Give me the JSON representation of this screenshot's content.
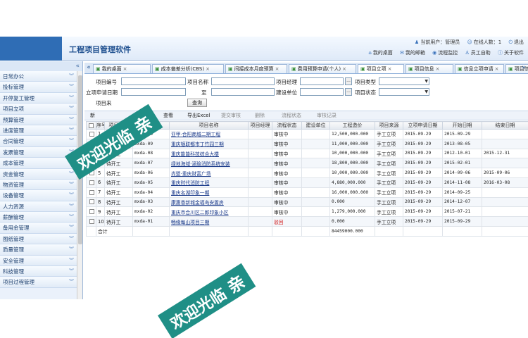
{
  "app": {
    "title": "工程项目管理软件",
    "current_user": "当前用户：管理员",
    "online_count": "在线人数：1",
    "logout": "退出",
    "links": [
      "我的桌面",
      "我的邮箱",
      "流程监控",
      "员工自助",
      "关于软件"
    ]
  },
  "sidebar": {
    "collapse_glyph": "«",
    "items": [
      "日常办公",
      "投标管理",
      "开停复工管理",
      "项目立项",
      "预算管理",
      "进度管理",
      "合同管理",
      "发票管理",
      "成本管理",
      "资金管理",
      "物资管理",
      "设备管理",
      "人力资源",
      "薪酬管理",
      "备用金管理",
      "图纸管理",
      "质量管理",
      "安全管理",
      "科技管理",
      "项目过程管理"
    ]
  },
  "tabs": [
    {
      "label": "我的桌面",
      "active": false
    },
    {
      "label": "成本偏差分析(CBS)",
      "active": false
    },
    {
      "label": "间接成本月度预算",
      "active": false
    },
    {
      "label": "费用预算申请(个人)",
      "active": false
    },
    {
      "label": "项目立项",
      "active": true
    },
    {
      "label": "项目信息",
      "active": false
    },
    {
      "label": "信息立项申请",
      "active": false
    },
    {
      "label": "项目信息一览",
      "active": false
    }
  ],
  "form": {
    "project_no": "项目编号",
    "project_name": "项目名称",
    "project_manager": "项目经理",
    "project_type": "项目类型",
    "apply_date": "立项申请日期",
    "to": "至",
    "build_unit": "建设单位",
    "project_status": "项目状态",
    "project_source": "项目来",
    "query": "查询"
  },
  "toolbar": {
    "buttons": [
      "新",
      "查看",
      "导出Excel",
      "提交审核",
      "删除",
      "流程状态",
      "审核记录"
    ]
  },
  "table": {
    "columns": [
      "",
      "序号",
      "项目状态",
      "项目编号",
      "项目名称",
      "项目经理",
      "流程状态",
      "建设单位",
      "工程造价",
      "项目来源",
      "立项申请日期",
      "开始日期",
      "结束日期"
    ],
    "rows": [
      {
        "no": "1",
        "status": "待开工",
        "code": "mxda-10",
        "name": "亚甲·合阳商城二期工程",
        "flow": "审核中",
        "cost": "12,500,000.000",
        "source": "手工立项",
        "apply": "2015-09-29",
        "start": "2015-09-29",
        "end": ""
      },
      {
        "no": "2",
        "status": "待开工",
        "code": "mxda-09",
        "name": "重庆银联都市丁竹园三期",
        "flow": "审核中",
        "cost": "11,000,000.000",
        "source": "手工立项",
        "apply": "2015-09-29",
        "start": "2013-08-05",
        "end": ""
      },
      {
        "no": "3",
        "status": "待开工",
        "code": "mxda-08",
        "name": "重庆能能科技综合大楼",
        "flow": "审核中",
        "cost": "10,000,000.000",
        "source": "手工立项",
        "apply": "2015-09-29",
        "start": "2012-10-01",
        "end": "2015-12-31"
      },
      {
        "no": "4",
        "status": "待开工",
        "code": "mxda-07",
        "name": "绿地海域·涵瑜消防系统安装",
        "flow": "审核中",
        "cost": "18,800,000.000",
        "source": "手工立项",
        "apply": "2015-09-29",
        "start": "2015-02-01",
        "end": ""
      },
      {
        "no": "5",
        "status": "待开工",
        "code": "mxda-06",
        "name": "尚盟·重庆财富广场",
        "flow": "审核中",
        "cost": "10,000,000.000",
        "source": "手工立项",
        "apply": "2015-09-29",
        "start": "2014-09-06",
        "end": "2015-09-06"
      },
      {
        "no": "6",
        "status": "待开工",
        "code": "mxda-05",
        "name": "重庆时代消防工程",
        "flow": "审核中",
        "cost": "4,880,000.000",
        "source": "手工立项",
        "apply": "2015-09-29",
        "start": "2014-11-08",
        "end": "2016-03-08"
      },
      {
        "no": "7",
        "status": "待开工",
        "code": "mxda-04",
        "name": "重庆名湖印象一期",
        "flow": "审核中",
        "cost": "16,000,000.000",
        "source": "手工立项",
        "apply": "2015-09-29",
        "start": "2014-09-25",
        "end": ""
      },
      {
        "no": "8",
        "status": "待开工",
        "code": "mxda-03",
        "name": "康惠香新城金福岛安置房",
        "flow": "审核中",
        "cost": "0.000",
        "source": "手工立项",
        "apply": "2015-09-29",
        "start": "2014-12-07",
        "end": ""
      },
      {
        "no": "9",
        "status": "待开工",
        "code": "mxda-02",
        "name": "重庆市合川区二郎印象小区",
        "flow": "审核中",
        "cost": "1,279,000.000",
        "source": "手工立项",
        "apply": "2015-09-29",
        "start": "2015-07-21",
        "end": ""
      },
      {
        "no": "10",
        "status": "待开工",
        "code": "mxda-01",
        "name": "畅缘每山项目三期",
        "flow": "驳回",
        "cost": "0.000",
        "source": "手工立项",
        "apply": "2015-09-29",
        "start": "2015-09-29",
        "end": ""
      }
    ],
    "total_label": "合计",
    "total_cost": "84459000.000"
  },
  "watermark": {
    "text": "欢迎光临",
    "suffix": "亲"
  },
  "colors": {
    "accent": "#2f6db5",
    "watermark": "#1f8f86",
    "reject": "#d21e1e"
  }
}
